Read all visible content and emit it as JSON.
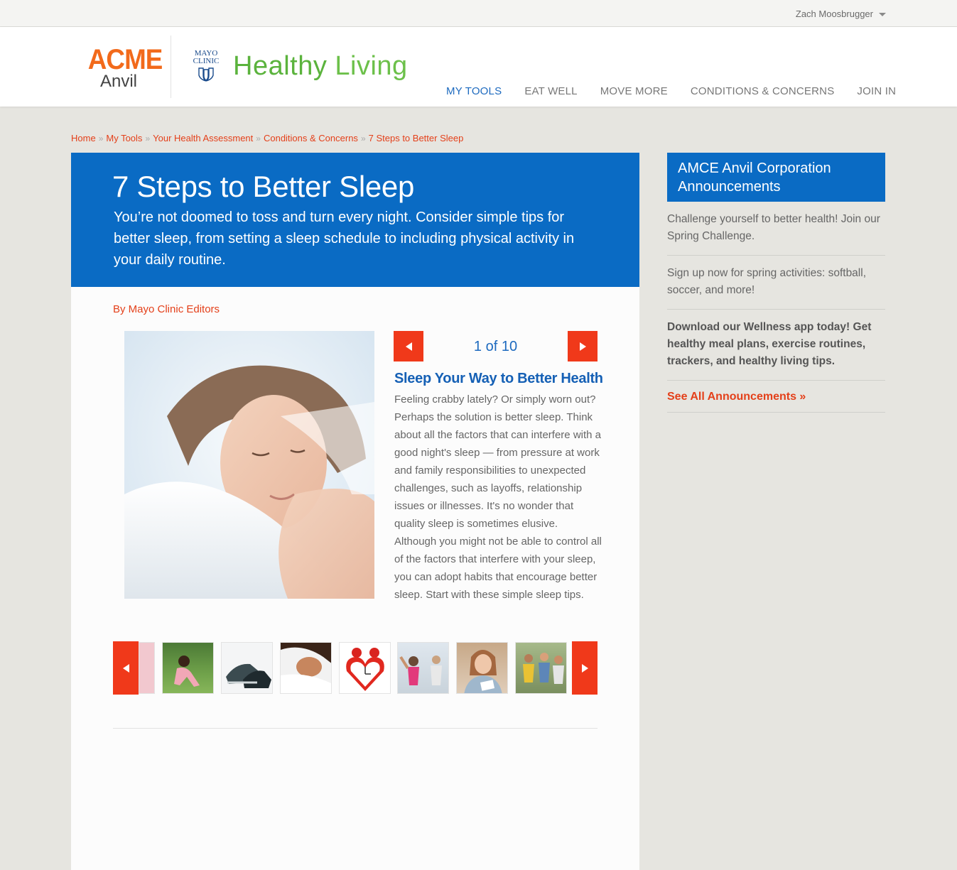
{
  "userbar": {
    "username": "Zach Moosbrugger"
  },
  "header": {
    "acme_line1": "ACME",
    "acme_line2": "Anvil",
    "mayo_line1": "MAYO",
    "mayo_line2": "CLINIC",
    "brand_healthy": "Healthy",
    "brand_living": "Living",
    "nav": [
      {
        "label": "MY TOOLS"
      },
      {
        "label": "EAT WELL"
      },
      {
        "label": "MOVE MORE"
      },
      {
        "label": "CONDITIONS & CONCERNS"
      },
      {
        "label": "JOIN IN"
      }
    ]
  },
  "breadcrumb": [
    "Home",
    "My Tools",
    "Your Health Assessment",
    "Conditions & Concerns",
    "7 Steps to Better Sleep"
  ],
  "article": {
    "title": "7 Steps to Better Sleep",
    "intro": "You’re not doomed to toss and turn every night. Consider simple tips for better sleep, from setting a sleep schedule to including physical activity in your daily routine.",
    "byline": "By Mayo Clinic Editors",
    "pager": {
      "current": 1,
      "total": 10,
      "text": "1 of 10"
    },
    "slide_title": "Sleep Your Way to Better Health",
    "slide_body": "Feeling crabby lately? Or simply worn out? Perhaps the solution is better sleep. Think about all the factors that can interfere with a good night's sleep — from pressure at work and family responsibilities to unexpected challenges, such as layoffs, relationship issues or illnesses. It's no wonder that quality sleep is sometimes elusive. Although you might not be able to control all of the factors that interfere with your sleep, you can adopt habits that encourage better sleep. Start with these simple sleep tips."
  },
  "sidebar": {
    "heading": "AMCE Anvil Corporation Announcements",
    "announcements": [
      {
        "text": "Challenge yourself to better health! Join our Spring Challenge."
      },
      {
        "text": "Sign up now for spring activities: softball, soccer, and more!"
      },
      {
        "text": "Download our Wellness app today! Get healthy meal plans, exercise routines, trackers, and healthy living tips."
      }
    ],
    "see_all": "See All Announcements »"
  },
  "colors": {
    "accent_blue": "#0a6bc4",
    "accent_orange": "#f0391a",
    "brand_green": "#5bb33d",
    "acme_orange": "#f26a1b"
  }
}
